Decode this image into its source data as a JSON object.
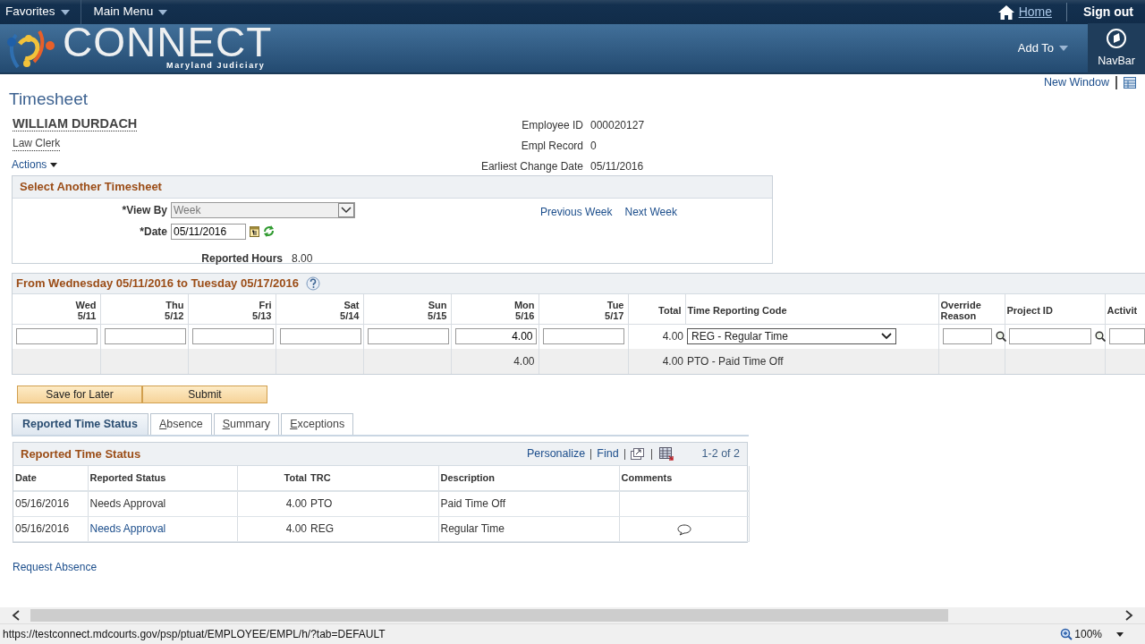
{
  "top_bar": {
    "menus": [
      {
        "label": "Favorites"
      },
      {
        "label": "Main Menu"
      }
    ],
    "home": "Home",
    "sign_out": "Sign out"
  },
  "banner": {
    "logo_text": "CONNECT",
    "logo_subtitle": "Maryland Judiciary",
    "add_to": "Add To",
    "navbar": "NavBar"
  },
  "new_window": "New Window",
  "page_title": "Timesheet",
  "employee": {
    "name": "WILLIAM DURDACH",
    "job_title": "Law Clerk",
    "actions": "Actions",
    "fields": [
      {
        "label": "Employee ID",
        "value": "000020127"
      },
      {
        "label": "Empl Record",
        "value": "0"
      },
      {
        "label": "Earliest Change Date",
        "value": "05/11/2016"
      }
    ]
  },
  "select_timesheet": {
    "title": "Select Another Timesheet",
    "view_by": {
      "label": "*View By",
      "value": "Week",
      "disabled": true
    },
    "date": {
      "label": "*Date",
      "value": "05/11/2016"
    },
    "links": [
      "Previous Week",
      "Next Week"
    ],
    "reported_hours": {
      "label": "Reported Hours",
      "value": "8.00"
    }
  },
  "time_grid": {
    "title": "From Wednesday 05/11/2016 to Tuesday 05/17/2016",
    "days": [
      {
        "day": "Wed",
        "date": "5/11"
      },
      {
        "day": "Thu",
        "date": "5/12"
      },
      {
        "day": "Fri",
        "date": "5/13"
      },
      {
        "day": "Sat",
        "date": "5/14"
      },
      {
        "day": "Sun",
        "date": "5/15"
      },
      {
        "day": "Mon",
        "date": "5/16"
      },
      {
        "day": "Tue",
        "date": "5/17"
      }
    ],
    "total_label": "Total",
    "trc_label": "Time Reporting Code",
    "extra_columns": [
      "Override Reason",
      "Project ID",
      "Activit"
    ],
    "rows": [
      {
        "kind": "editable",
        "cells": [
          {
            "kind": "blank"
          },
          {
            "kind": "blank"
          },
          {
            "kind": "blank"
          },
          {
            "kind": "blank"
          },
          {
            "kind": "blank"
          },
          {
            "kind": "hours",
            "value": "4.00"
          },
          {
            "kind": "blank"
          }
        ],
        "total": "4.00",
        "trc": "REG - Regular Time"
      },
      {
        "kind": "readonly",
        "cells": [
          {
            "kind": "blank"
          },
          {
            "kind": "blank"
          },
          {
            "kind": "blank"
          },
          {
            "kind": "blank"
          },
          {
            "kind": "blank"
          },
          {
            "kind": "hours",
            "value": "4.00"
          },
          {
            "kind": "blank"
          }
        ],
        "total": "4.00",
        "trc": "PTO - Paid Time Off"
      }
    ]
  },
  "buttons": [
    "Save for Later",
    "Submit"
  ],
  "tabs": [
    {
      "label": "Reported Time Status",
      "selected": true
    },
    {
      "label": "Absence",
      "selected": false
    },
    {
      "label": "Summary",
      "selected": false
    },
    {
      "label": "Exceptions",
      "selected": false
    }
  ],
  "status_grid": {
    "title": "Reported Time Status",
    "tools": [
      "Personalize",
      "Find"
    ],
    "count": "1-2 of 2",
    "columns": [
      "Date",
      "Reported Status",
      "Total",
      "TRC",
      "Description",
      "Comments"
    ],
    "rows": [
      {
        "date": "05/16/2016",
        "status": "Needs Approval",
        "status_link": false,
        "total": "4.00",
        "trc": "PTO",
        "description": "Paid Time Off",
        "has_comment": false
      },
      {
        "date": "05/16/2016",
        "status": "Needs Approval",
        "status_link": true,
        "total": "4.00",
        "trc": "REG",
        "description": "Regular Time",
        "has_comment": true
      }
    ]
  },
  "request_absence": "Request Absence",
  "browser": {
    "url": "https://testconnect.mdcourts.gov/psp/ptuat/EMPLOYEE/EMPL/h/?tab=DEFAULT",
    "zoom": "100%"
  }
}
